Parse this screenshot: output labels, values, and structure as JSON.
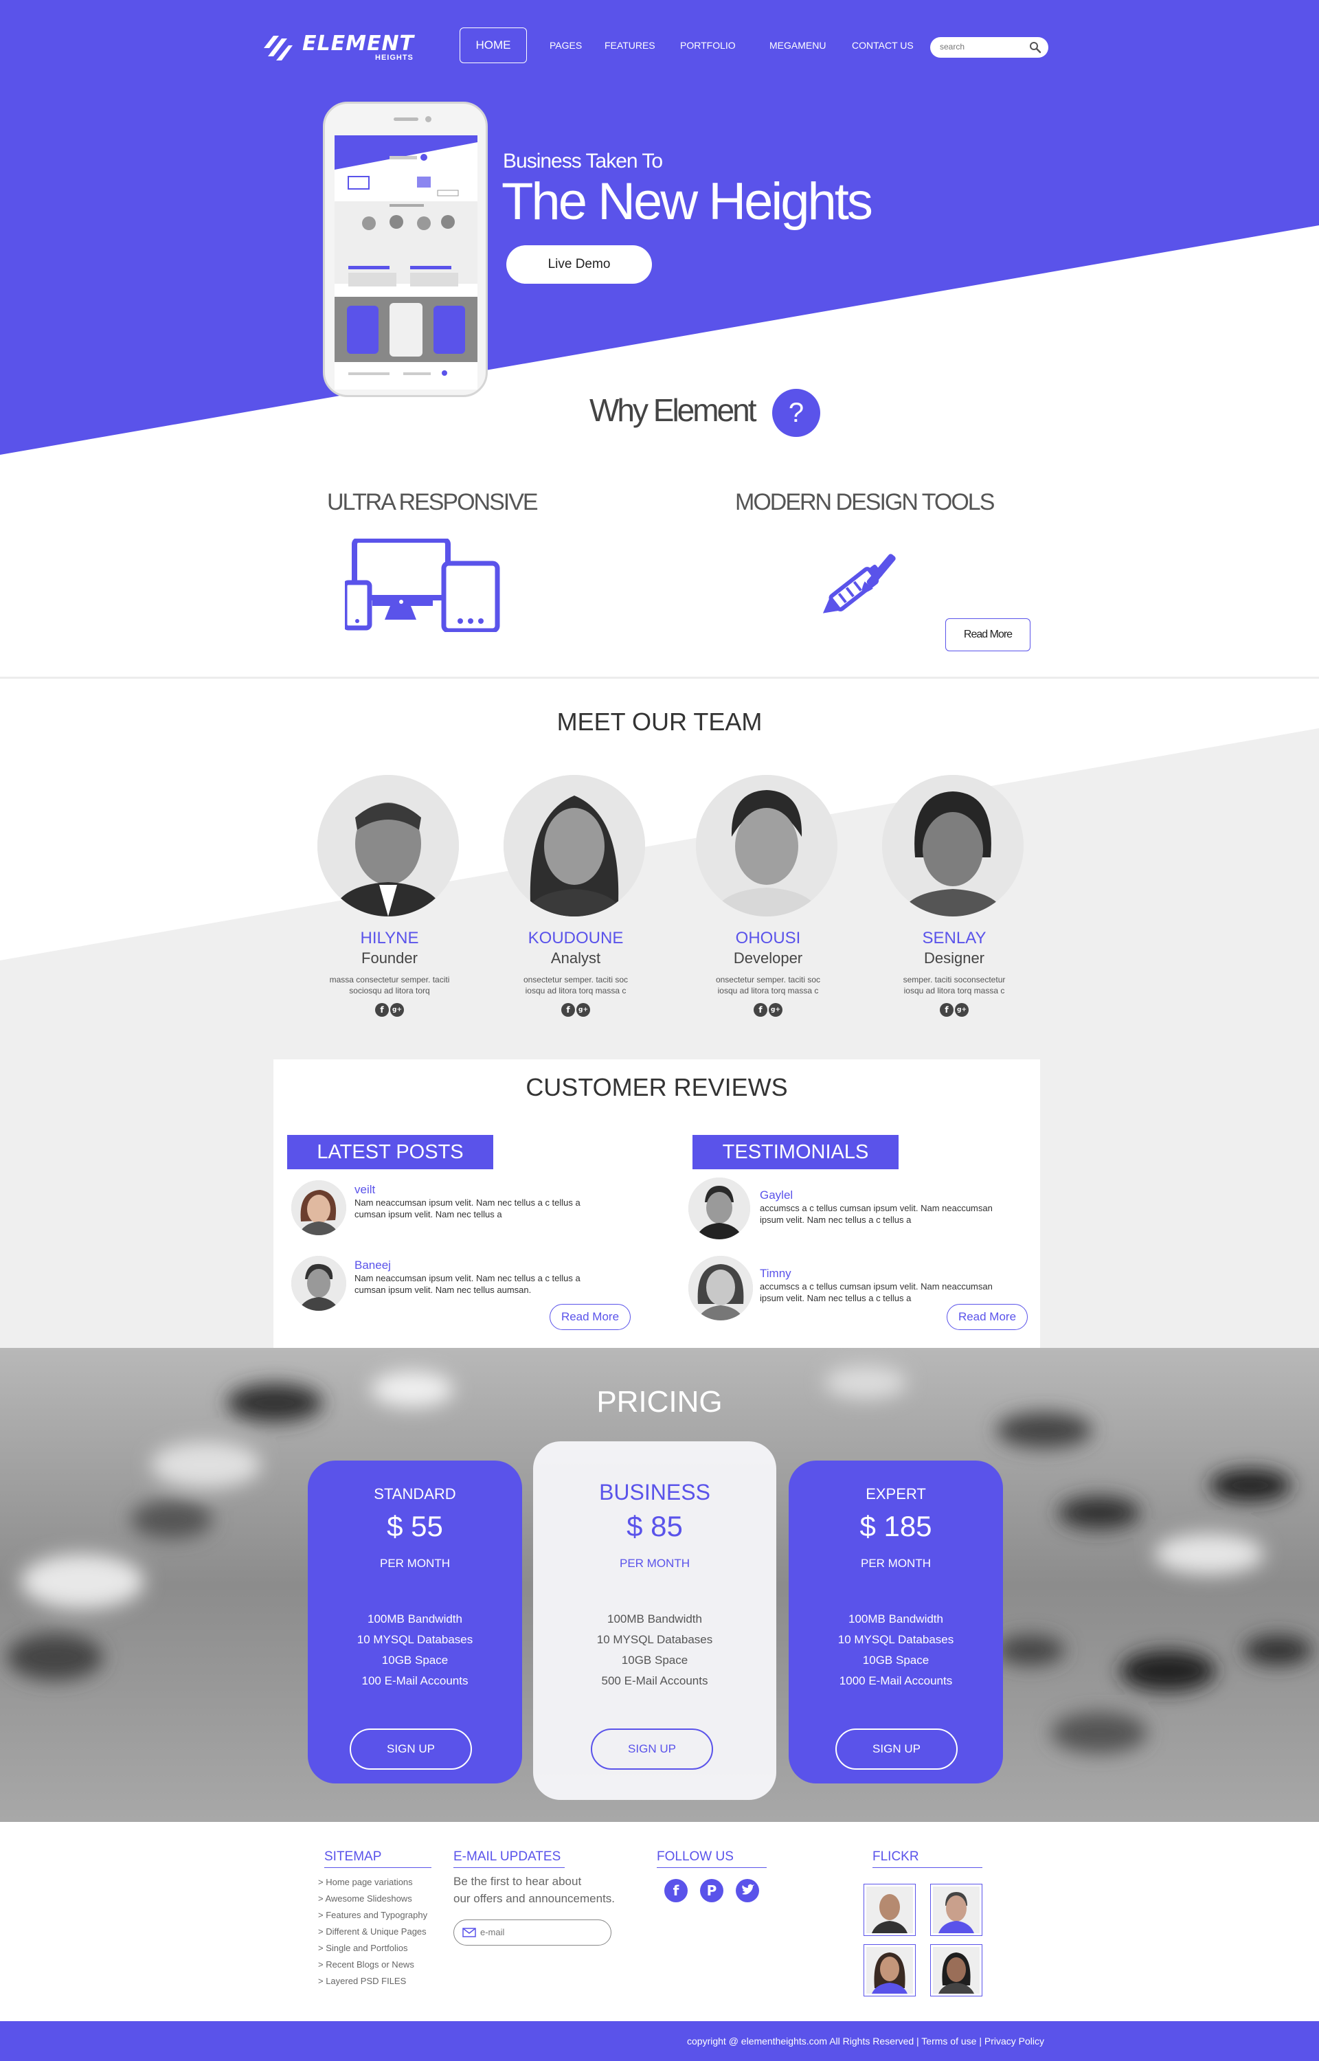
{
  "brand": {
    "logo_text": "ELEMENT",
    "logo_sub": "HEIGHTS"
  },
  "nav": {
    "home": "HOME",
    "items": [
      "PAGES",
      "FEATURES",
      "PORTFOLIO",
      "MEGAMENU",
      "CONTACT US"
    ],
    "search_placeholder": "search"
  },
  "hero": {
    "subtitle": "Business Taken To",
    "title": "The New Heights",
    "cta": "Live Demo"
  },
  "why": {
    "title": "Why Element",
    "question": "?",
    "features": [
      "ULTRA RESPONSIVE",
      "MODERN DESIGN TOOLS"
    ],
    "read_more": "Read More"
  },
  "team": {
    "title": "MEET OUR TEAM",
    "members": [
      {
        "name": "HILYNE",
        "role": "Founder",
        "desc": "massa consectetur semper. taciti sociosqu ad litora torq"
      },
      {
        "name": "KOUDOUNE",
        "role": "Analyst",
        "desc": "onsectetur semper. taciti soc iosqu ad litora torq massa c"
      },
      {
        "name": "OHOUSI",
        "role": "Developer",
        "desc": "onsectetur semper. taciti soc iosqu ad litora torq massa c"
      },
      {
        "name": "SENLAY",
        "role": "Designer",
        "desc": "semper. taciti soconsectetur iosqu ad litora torq massa c"
      }
    ],
    "social": [
      "f",
      "g+"
    ]
  },
  "reviews": {
    "title": "CUSTOMER REVIEWS",
    "latest_label": "LATEST POSTS",
    "testimonials_label": "TESTIMONIALS",
    "latest": [
      {
        "name": "veilt",
        "text": "Nam neaccumsan ipsum velit. Nam nec tellus a c tellus a cumsan ipsum velit. Nam nec tellus a"
      },
      {
        "name": "Baneej",
        "text": "Nam neaccumsan ipsum velit. Nam nec tellus a c tellus a cumsan ipsum velit. Nam nec tellus aumsan."
      }
    ],
    "testimonials": [
      {
        "name": "Gaylel",
        "text": "accumscs a c tellus cumsan ipsum velit. Nam neaccumsan ipsum velit. Nam nec tellus a c tellus a"
      },
      {
        "name": "Timny",
        "text": "accumscs a c tellus cumsan ipsum velit. Nam neaccumsan ipsum velit. Nam nec tellus a c tellus a"
      }
    ],
    "read_more": "Read More"
  },
  "pricing": {
    "title": "PRICING",
    "plans": [
      {
        "name": "STANDARD",
        "price": "$ 55",
        "per": "PER MONTH",
        "features": [
          "100MB Bandwidth",
          "10 MYSQL Databases",
          "10GB Space",
          "100 E-Mail Accounts"
        ],
        "cta": "SIGN UP"
      },
      {
        "name": "BUSINESS",
        "price": "$ 85",
        "per": "PER MONTH",
        "features": [
          "100MB Bandwidth",
          "10 MYSQL Databases",
          "10GB Space",
          "500 E-Mail Accounts"
        ],
        "cta": "SIGN UP"
      },
      {
        "name": "EXPERT",
        "price": "$ 185",
        "per": "PER MONTH",
        "features": [
          "100MB Bandwidth",
          "10 MYSQL Databases",
          "10GB Space",
          "1000 E-Mail Accounts"
        ],
        "cta": "SIGN UP"
      }
    ]
  },
  "footer": {
    "sitemap_title": "SITEMAP",
    "sitemap_links": [
      "> Home page variations",
      "> Awesome Slideshows",
      "> Features and Typography",
      "> Different & Unique Pages",
      "> Single and Portfolios",
      "> Recent Blogs or News",
      "> Layered PSD FILES"
    ],
    "email_title": "E-MAIL UPDATES",
    "email_text_1": "Be the first to hear about",
    "email_text_2": "our offers and announcements.",
    "email_placeholder": "e-mail",
    "follow_title": "FOLLOW US",
    "flickr_title": "FLICKR",
    "copyright": "copyright @ elementheights.com All Rights Reserved | Terms of use | Privacy Policy"
  },
  "colors": {
    "accent": "#5a53ea",
    "light_gray": "#efefef"
  }
}
